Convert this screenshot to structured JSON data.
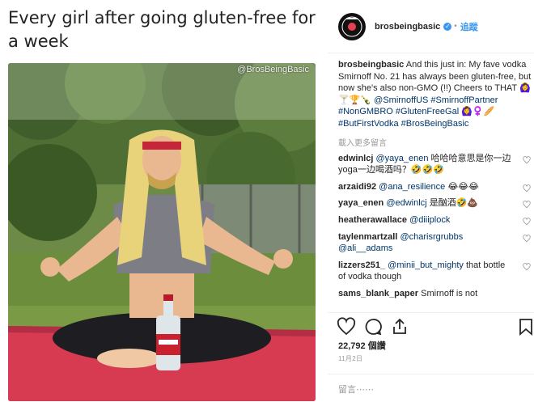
{
  "meme": {
    "caption": "Every girl after going gluten-free for a week",
    "watermark": "@BrosBeingBasic"
  },
  "header": {
    "username": "brosbeingbasic",
    "verified_mark": "✓",
    "separator": "•",
    "follow_label": "追蹤"
  },
  "caption": {
    "username": "brosbeingbasic",
    "text": "And this just in: My fave vodka Smirnoff No. 21 has always been gluten-free, but now she's also non-GMO (!!) Cheers to THAT 🙆‍♀️🍸🏆🍾",
    "tags": "@SmirnoffUS #SmirnoffPartner #NonGMBRO #GlutenFreeGal 🙆‍♀️♀️🥖 #ButFirstVodka #BrosBeingBasic"
  },
  "load_more_label": "載入更多留言",
  "comments": [
    {
      "user": "edwinlcj",
      "mention": "@yaya_enen",
      "text": "哈哈哈意思是你一边yoga一边喝酒吗？🤣🤣🤣"
    },
    {
      "user": "arzaidi92",
      "mention": "@ana_resilience",
      "text": "😂😂😂"
    },
    {
      "user": "yaya_enen",
      "mention": "@edwinlcj",
      "text": "是酗酒🤣💩"
    },
    {
      "user": "heatherawallace",
      "mention": "@diiiplock",
      "text": ""
    },
    {
      "user": "taylenmartzall",
      "mention": "@charisrgrubbs @ali__adams",
      "text": ""
    },
    {
      "user": "lizzers251_",
      "mention": "@minii_but_mighty",
      "text": "that bottle of vodka though"
    },
    {
      "user": "sams_blank_paper",
      "mention": "",
      "text": "Smirnoff is not"
    }
  ],
  "likes_label": "22,792 個讚",
  "date_label": "11月2日",
  "comment_placeholder": "留言⋯⋯",
  "icons": {
    "like": "heart-icon",
    "comment": "comment-icon",
    "share": "share-icon",
    "save": "bookmark-icon"
  },
  "colors": {
    "link": "#003569",
    "follow": "#3897f0",
    "muted": "#999999",
    "text": "#262626"
  }
}
